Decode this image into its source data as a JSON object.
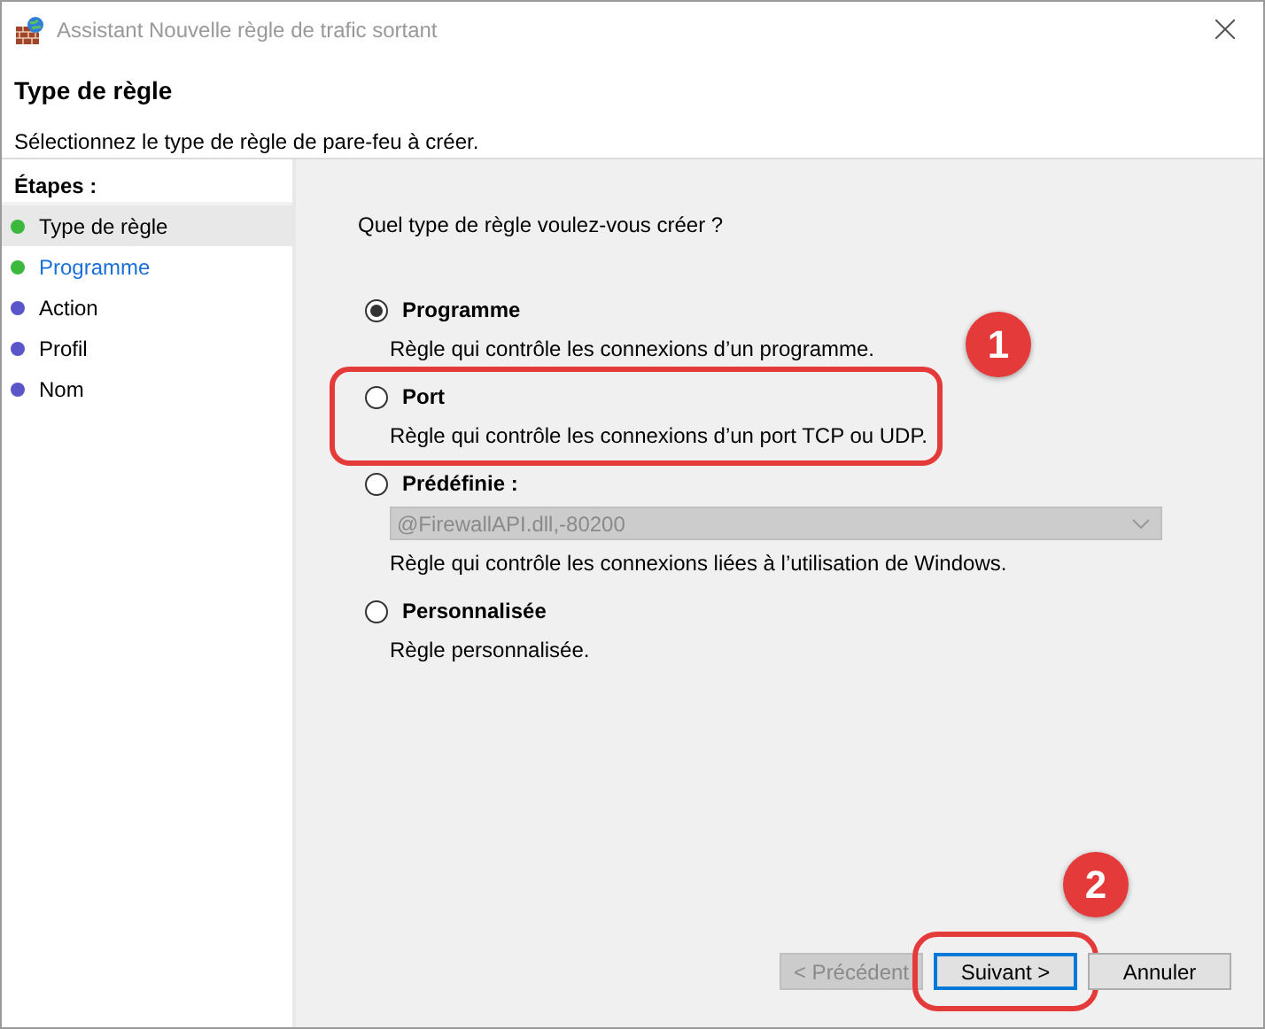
{
  "window": {
    "title": "Assistant Nouvelle règle de trafic sortant"
  },
  "header": {
    "title": "Type de règle",
    "subtitle": "Sélectionnez le type de règle de pare-feu à créer."
  },
  "steps": {
    "heading": "Étapes :",
    "items": [
      {
        "label": "Type de règle",
        "selected": true,
        "hovered": false,
        "color": "#3cb83c"
      },
      {
        "label": "Programme",
        "selected": false,
        "hovered": true,
        "color": "#3cb83c"
      },
      {
        "label": "Action",
        "selected": false,
        "hovered": false,
        "color": "#5a55c8"
      },
      {
        "label": "Profil",
        "selected": false,
        "hovered": false,
        "color": "#5a55c8"
      },
      {
        "label": "Nom",
        "selected": false,
        "hovered": false,
        "color": "#5a55c8"
      }
    ]
  },
  "question": "Quel type de règle voulez-vous créer ?",
  "options": [
    {
      "label": "Programme",
      "description": "Règle qui contrôle les connexions d’un programme.",
      "selected": true,
      "highlighted": false
    },
    {
      "label": "Port",
      "description": "Règle qui contrôle les connexions d’un port TCP ou UDP.",
      "selected": false,
      "highlighted": true
    },
    {
      "label": "Prédéfinie :",
      "description": "Règle qui contrôle les connexions liées à l’utilisation de Windows.",
      "selected": false,
      "highlighted": false,
      "dropdown": {
        "value": "@FirewallAPI.dll,-80200",
        "disabled": true
      }
    },
    {
      "label": "Personnalisée",
      "description": "Règle personnalisée.",
      "selected": false,
      "highlighted": false
    }
  ],
  "buttons": [
    {
      "label": "< Précédent",
      "disabled": true,
      "focused": false,
      "highlighted": false
    },
    {
      "label": "Suivant >",
      "disabled": false,
      "focused": true,
      "highlighted": true
    },
    {
      "label": "Annuler",
      "disabled": false,
      "focused": false,
      "highlighted": false
    }
  ],
  "callouts": [
    "1",
    "2"
  ]
}
